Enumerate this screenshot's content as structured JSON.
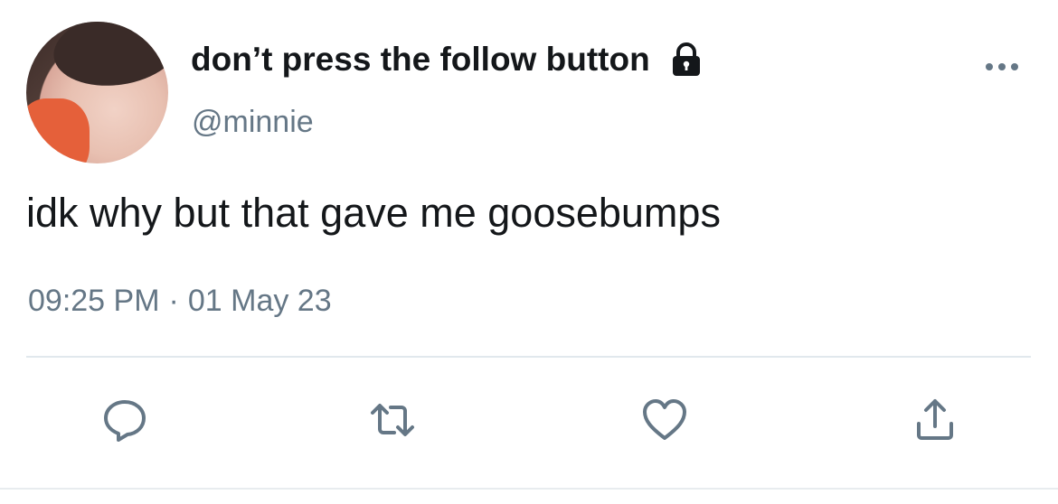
{
  "tweet": {
    "display_name": "don’t press the follow button",
    "handle": "@minnie",
    "text": "idk why but that gave me goosebumps",
    "time": "09:25 PM",
    "separator": "·",
    "date": "01 May 23"
  },
  "icons": {
    "lock": "lock-icon",
    "more": "more-horizontal-icon",
    "reply": "reply-icon",
    "retweet": "retweet-icon",
    "like": "heart-icon",
    "share": "share-icon"
  },
  "colors": {
    "text_primary": "#14171a",
    "text_secondary": "#657786",
    "icon": "#657786",
    "divider": "#e1e8ed"
  }
}
